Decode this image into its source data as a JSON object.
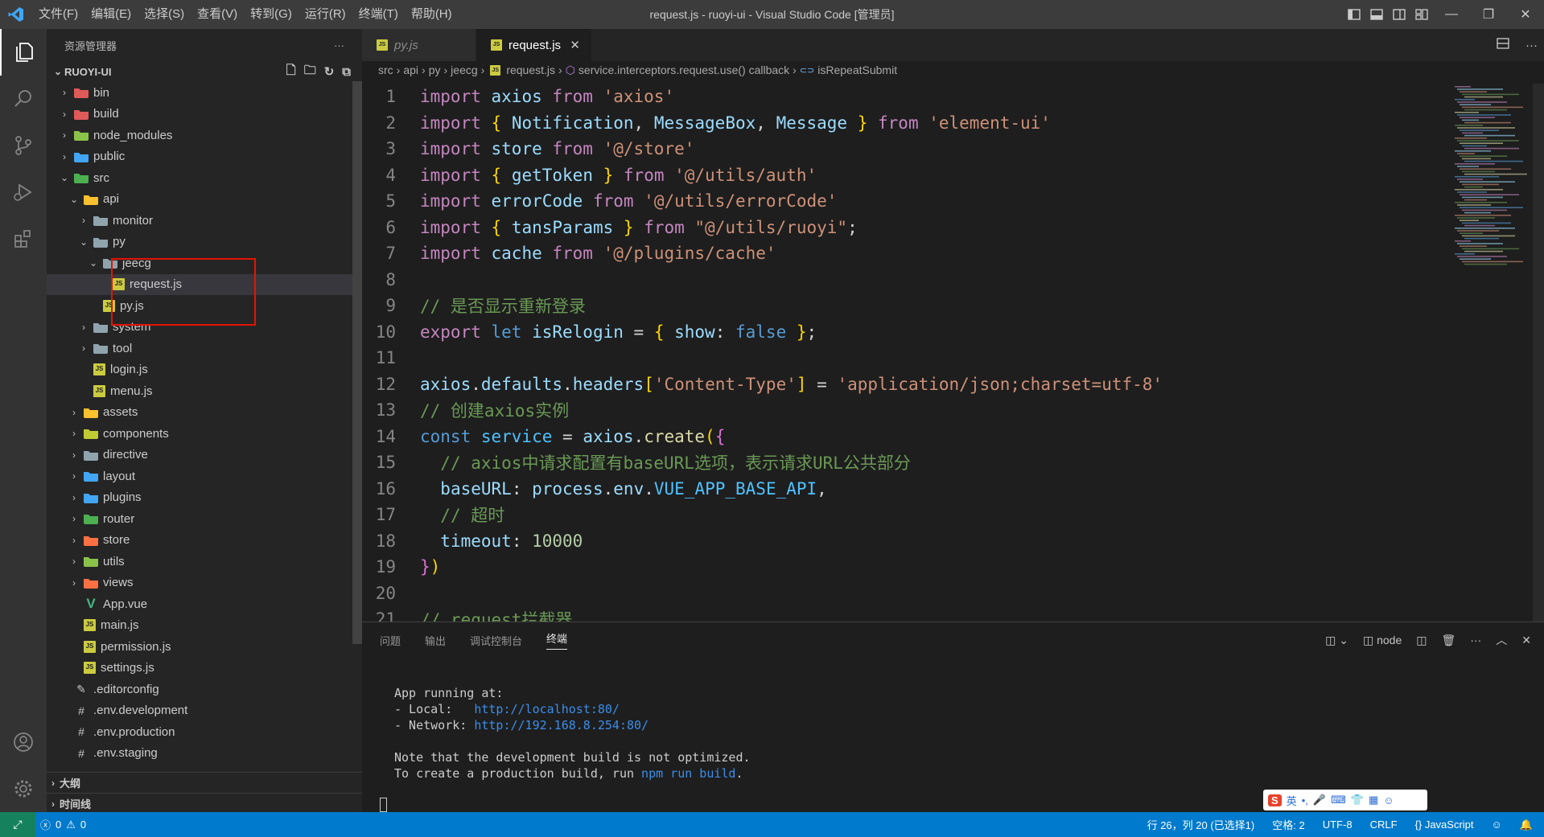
{
  "titlebar": {
    "menu": [
      "文件(F)",
      "编辑(E)",
      "选择(S)",
      "查看(V)",
      "转到(G)",
      "运行(R)",
      "终端(T)",
      "帮助(H)"
    ],
    "window_title": "request.js - ruoyi-ui - Visual Studio Code [管理员]"
  },
  "sidebar": {
    "header": "资源管理器",
    "project": "RUOYI-UI",
    "outline": "大纲",
    "timeline": "时间线"
  },
  "tree": [
    {
      "label": "bin",
      "indent": 0,
      "kind": "folder",
      "open": false,
      "color": "#e05a5a"
    },
    {
      "label": "build",
      "indent": 0,
      "kind": "folder",
      "open": false,
      "color": "#e05a5a"
    },
    {
      "label": "node_modules",
      "indent": 0,
      "kind": "folder",
      "open": false,
      "color": "#8bc34a"
    },
    {
      "label": "public",
      "indent": 0,
      "kind": "folder",
      "open": false,
      "color": "#42a5f5"
    },
    {
      "label": "src",
      "indent": 0,
      "kind": "folder",
      "open": true,
      "color": "#4caf50"
    },
    {
      "label": "api",
      "indent": 1,
      "kind": "folder",
      "open": true,
      "color": "#fbc02d"
    },
    {
      "label": "monitor",
      "indent": 2,
      "kind": "folder",
      "open": false,
      "color": "#90a4ae"
    },
    {
      "label": "py",
      "indent": 2,
      "kind": "folder",
      "open": true,
      "color": "#90a4ae"
    },
    {
      "label": "jeecg",
      "indent": 3,
      "kind": "folder",
      "open": true,
      "color": "#90a4ae"
    },
    {
      "label": "request.js",
      "indent": 4,
      "kind": "js",
      "selected": true
    },
    {
      "label": "py.js",
      "indent": 3,
      "kind": "js"
    },
    {
      "label": "system",
      "indent": 2,
      "kind": "folder",
      "open": false,
      "color": "#90a4ae"
    },
    {
      "label": "tool",
      "indent": 2,
      "kind": "folder",
      "open": false,
      "color": "#90a4ae"
    },
    {
      "label": "login.js",
      "indent": 2,
      "kind": "js"
    },
    {
      "label": "menu.js",
      "indent": 2,
      "kind": "js"
    },
    {
      "label": "assets",
      "indent": 1,
      "kind": "folder",
      "open": false,
      "color": "#fbc02d"
    },
    {
      "label": "components",
      "indent": 1,
      "kind": "folder",
      "open": false,
      "color": "#c0ca33"
    },
    {
      "label": "directive",
      "indent": 1,
      "kind": "folder",
      "open": false,
      "color": "#90a4ae"
    },
    {
      "label": "layout",
      "indent": 1,
      "kind": "folder",
      "open": false,
      "color": "#42a5f5"
    },
    {
      "label": "plugins",
      "indent": 1,
      "kind": "folder",
      "open": false,
      "color": "#42a5f5"
    },
    {
      "label": "router",
      "indent": 1,
      "kind": "folder",
      "open": false,
      "color": "#4caf50"
    },
    {
      "label": "store",
      "indent": 1,
      "kind": "folder",
      "open": false,
      "color": "#ff7043"
    },
    {
      "label": "utils",
      "indent": 1,
      "kind": "folder",
      "open": false,
      "color": "#8bc34a"
    },
    {
      "label": "views",
      "indent": 1,
      "kind": "folder",
      "open": false,
      "color": "#ff7043"
    },
    {
      "label": "App.vue",
      "indent": 1,
      "kind": "vue"
    },
    {
      "label": "main.js",
      "indent": 1,
      "kind": "js"
    },
    {
      "label": "permission.js",
      "indent": 1,
      "kind": "js"
    },
    {
      "label": "settings.js",
      "indent": 1,
      "kind": "js"
    },
    {
      "label": ".editorconfig",
      "indent": 0,
      "kind": "cfg"
    },
    {
      "label": ".env.development",
      "indent": 0,
      "kind": "env"
    },
    {
      "label": ".env.production",
      "indent": 0,
      "kind": "env"
    },
    {
      "label": ".env.staging",
      "indent": 0,
      "kind": "env"
    }
  ],
  "tabs": [
    {
      "label": "py.js",
      "active": false
    },
    {
      "label": "request.js",
      "active": true
    }
  ],
  "breadcrumb": [
    "src",
    "api",
    "py",
    "jeecg",
    "request.js",
    "service.interceptors.request.use() callback",
    "isRepeatSubmit"
  ],
  "code": [
    {
      "n": "1",
      "t": [
        [
          "kc",
          "import "
        ],
        [
          "var",
          "axios "
        ],
        [
          "kc",
          "from "
        ],
        [
          "str",
          "'axios'"
        ]
      ]
    },
    {
      "n": "2",
      "t": [
        [
          "kc",
          "import "
        ],
        [
          "brace",
          "{ "
        ],
        [
          "var",
          "Notification"
        ],
        [
          "plain",
          ", "
        ],
        [
          "var",
          "MessageBox"
        ],
        [
          "plain",
          ", "
        ],
        [
          "var",
          "Message "
        ],
        [
          "brace",
          "} "
        ],
        [
          "kc",
          "from "
        ],
        [
          "str",
          "'element-ui'"
        ]
      ]
    },
    {
      "n": "3",
      "t": [
        [
          "kc",
          "import "
        ],
        [
          "var",
          "store "
        ],
        [
          "kc",
          "from "
        ],
        [
          "str",
          "'@/store'"
        ]
      ]
    },
    {
      "n": "4",
      "t": [
        [
          "kc",
          "import "
        ],
        [
          "brace",
          "{ "
        ],
        [
          "var",
          "getToken "
        ],
        [
          "brace",
          "} "
        ],
        [
          "kc",
          "from "
        ],
        [
          "str",
          "'@/utils/auth'"
        ]
      ]
    },
    {
      "n": "5",
      "t": [
        [
          "kc",
          "import "
        ],
        [
          "var",
          "errorCode "
        ],
        [
          "kc",
          "from "
        ],
        [
          "str",
          "'@/utils/errorCode'"
        ]
      ]
    },
    {
      "n": "6",
      "t": [
        [
          "kc",
          "import "
        ],
        [
          "brace",
          "{ "
        ],
        [
          "var",
          "tansParams "
        ],
        [
          "brace",
          "} "
        ],
        [
          "kc",
          "from "
        ],
        [
          "str",
          "\"@/utils/ruoyi\""
        ],
        [
          "plain",
          ";"
        ]
      ]
    },
    {
      "n": "7",
      "t": [
        [
          "kc",
          "import "
        ],
        [
          "var",
          "cache "
        ],
        [
          "kc",
          "from "
        ],
        [
          "str",
          "'@/plugins/cache'"
        ]
      ]
    },
    {
      "n": "8",
      "t": []
    },
    {
      "n": "9",
      "t": [
        [
          "cmt",
          "// 是否显示重新登录"
        ]
      ]
    },
    {
      "n": "10",
      "t": [
        [
          "kc",
          "export "
        ],
        [
          "kw",
          "let "
        ],
        [
          "var",
          "isRelogin "
        ],
        [
          "plain",
          "= "
        ],
        [
          "brace",
          "{ "
        ],
        [
          "var",
          "show"
        ],
        [
          "plain",
          ": "
        ],
        [
          "kw",
          "false "
        ],
        [
          "brace",
          "}"
        ],
        [
          "plain",
          ";"
        ]
      ]
    },
    {
      "n": "11",
      "t": []
    },
    {
      "n": "12",
      "t": [
        [
          "var",
          "axios"
        ],
        [
          "plain",
          "."
        ],
        [
          "var",
          "defaults"
        ],
        [
          "plain",
          "."
        ],
        [
          "var",
          "headers"
        ],
        [
          "brace",
          "["
        ],
        [
          "str",
          "'Content-Type'"
        ],
        [
          "brace",
          "]"
        ],
        [
          "plain",
          " = "
        ],
        [
          "str",
          "'application/json;charset=utf-8'"
        ]
      ]
    },
    {
      "n": "13",
      "t": [
        [
          "cmt",
          "// 创建axios实例"
        ]
      ]
    },
    {
      "n": "14",
      "t": [
        [
          "kw",
          "const "
        ],
        [
          "const",
          "service "
        ],
        [
          "plain",
          "= "
        ],
        [
          "var",
          "axios"
        ],
        [
          "plain",
          "."
        ],
        [
          "fn",
          "create"
        ],
        [
          "brace",
          "("
        ],
        [
          "brace2",
          "{"
        ]
      ]
    },
    {
      "n": "15",
      "t": [
        [
          "plain",
          "  "
        ],
        [
          "cmt",
          "// axios中请求配置有baseURL选项，表示请求URL公共部分"
        ]
      ]
    },
    {
      "n": "16",
      "t": [
        [
          "plain",
          "  "
        ],
        [
          "var",
          "baseURL"
        ],
        [
          "plain",
          ": "
        ],
        [
          "var",
          "process"
        ],
        [
          "plain",
          "."
        ],
        [
          "var",
          "env"
        ],
        [
          "plain",
          "."
        ],
        [
          "const",
          "VUE_APP_BASE_API"
        ],
        [
          "plain",
          ","
        ]
      ]
    },
    {
      "n": "17",
      "t": [
        [
          "plain",
          "  "
        ],
        [
          "cmt",
          "// 超时"
        ]
      ]
    },
    {
      "n": "18",
      "t": [
        [
          "plain",
          "  "
        ],
        [
          "var",
          "timeout"
        ],
        [
          "plain",
          ": "
        ],
        [
          "num",
          "10000"
        ]
      ]
    },
    {
      "n": "19",
      "t": [
        [
          "brace2",
          "}"
        ],
        [
          "brace",
          ")"
        ]
      ]
    },
    {
      "n": "20",
      "t": []
    },
    {
      "n": "21",
      "t": [
        [
          "cmt",
          "// request拦截器"
        ]
      ]
    }
  ],
  "panel": {
    "tabs": [
      "问题",
      "输出",
      "调试控制台",
      "终端"
    ],
    "active_tab": "终端",
    "terminal_name": "node",
    "terminal": {
      "l1": "App running at:",
      "l2a": "- Local:   ",
      "l2b": "http://localhost:80/",
      "l3a": "- Network: ",
      "l3b": "http://192.168.8.254:80/",
      "l4": "Note that the development build is not optimized.",
      "l5a": "To create a production build, run ",
      "l5b": "npm run build",
      "l5c": "."
    }
  },
  "ime": {
    "lang": "英"
  },
  "statusbar": {
    "errors": "0",
    "warnings": "0",
    "position": "行 26，列 20 (已选择1)",
    "spaces": "空格: 2",
    "encoding": "UTF-8",
    "eol": "CRLF",
    "language": "JavaScript"
  },
  "colors": {
    "accent": "#007acc",
    "selection_box": "#e51400"
  }
}
